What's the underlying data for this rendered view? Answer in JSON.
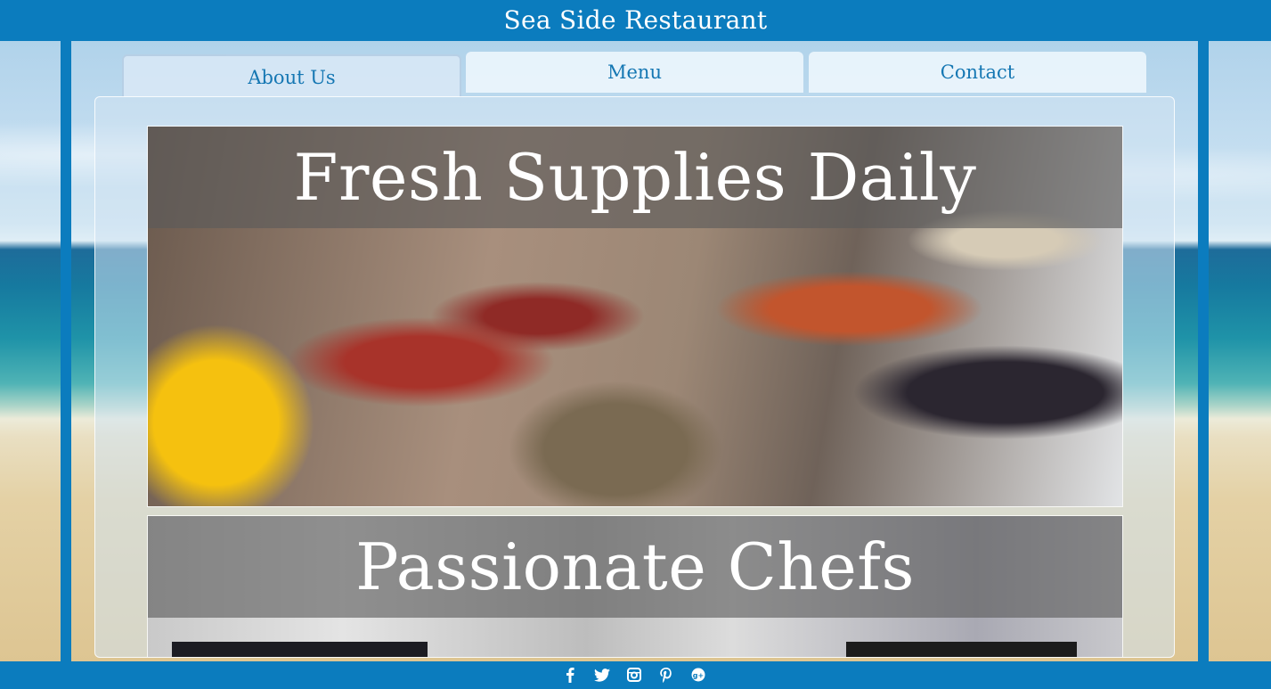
{
  "header": {
    "title": "Sea Side Restaurant"
  },
  "nav": {
    "tabs": [
      {
        "label": "About Us",
        "active": true
      },
      {
        "label": "Menu",
        "active": false
      },
      {
        "label": "Contact",
        "active": false
      }
    ]
  },
  "main": {
    "cards": [
      {
        "caption": "Fresh Supplies Daily",
        "image": "seafood-photo"
      },
      {
        "caption": "Passionate Chefs",
        "image": "kitchen-photo"
      }
    ]
  },
  "footer": {
    "social_icons": [
      "facebook-icon",
      "twitter-icon",
      "instagram-icon",
      "pinterest-icon",
      "google-plus-icon"
    ]
  },
  "colors": {
    "brand_blue": "#0b7cbe",
    "tab_text": "#1577b3",
    "caption_text": "#ffffff"
  }
}
